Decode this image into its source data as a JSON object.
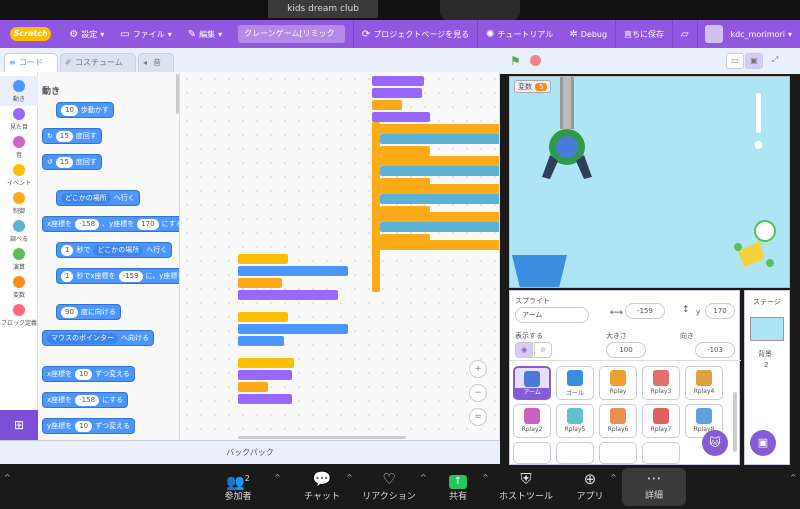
{
  "zoom": {
    "window_title": "kids dream club",
    "participants_count": "2",
    "toolbar": [
      {
        "label": "参加者",
        "icon": "participants-icon"
      },
      {
        "label": "チャット",
        "icon": "chat-icon"
      },
      {
        "label": "リアクション",
        "icon": "reaction-icon"
      },
      {
        "label": "共有",
        "icon": "share-icon"
      },
      {
        "label": "ホストツール",
        "icon": "host-tools-icon"
      },
      {
        "label": "アプリ",
        "icon": "apps-icon"
      },
      {
        "label": "詳細",
        "icon": "more-icon"
      }
    ]
  },
  "menubar": {
    "logo": "Scratch",
    "settings": "設定",
    "file": "ファイル",
    "edit": "編集",
    "project_title": "クレーンゲーム[リミックス...",
    "project_page": "プロジェクトページを見る",
    "tutorial": "チュートリアル",
    "debug": "Debug",
    "save_now": "直ちに保存",
    "username": "kdc_morimori"
  },
  "tabs": {
    "code": "コード",
    "costumes": "コスチューム",
    "sounds": "音"
  },
  "categories": [
    {
      "label": "動き",
      "color": "#4c97ff"
    },
    {
      "label": "見た目",
      "color": "#9966ff"
    },
    {
      "label": "音",
      "color": "#cf63cf"
    },
    {
      "label": "イベント",
      "color": "#ffbf00"
    },
    {
      "label": "制御",
      "color": "#ffab19"
    },
    {
      "label": "調べる",
      "color": "#5cb1d6"
    },
    {
      "label": "演算",
      "color": "#59c059"
    },
    {
      "label": "変数",
      "color": "#ff8c1a"
    },
    {
      "label": "ブロック定義",
      "color": "#ff6680"
    }
  ],
  "palette": {
    "title": "動き",
    "move": {
      "value": "10",
      "text": "歩動かす"
    },
    "turn_right": {
      "value": "15",
      "text": "度回す"
    },
    "turn_left": {
      "value": "15",
      "text": "度回す"
    },
    "goto": {
      "dropdown": "どこかの場所",
      "text": "へ行く"
    },
    "goto_xy": {
      "xlabel": "x座標を",
      "x": "-158",
      "ylabel": "、y座標を",
      "y": "170",
      "text": "にする"
    },
    "glide": {
      "value": "1",
      "text1": "秒で",
      "dropdown": "どこかの場所",
      "text2": "へ行く"
    },
    "glide_xy": {
      "value": "1",
      "text1": "秒でx座標を",
      "x": "-159",
      "text2": "に、y座標を"
    },
    "point_dir": {
      "value": "90",
      "text": "度に向ける"
    },
    "point_towards": {
      "dropdown": "マウスのポインター",
      "text": "へ向ける"
    },
    "change_x": {
      "text1": "x座標を",
      "value": "10",
      "text2": "ずつ変える"
    },
    "set_x": {
      "text1": "x座標を",
      "value": "-158",
      "text2": "にする"
    },
    "change_y": {
      "text1": "y座標を",
      "value": "10",
      "text2": "ずつ変える"
    }
  },
  "backpack": "バックパック",
  "stage": {
    "variable_label": "変数",
    "variable_value": "5"
  },
  "sprite": {
    "label": "スプライト",
    "name": "アーム",
    "x_value": "-159",
    "y_value": "170",
    "show_label": "表示する",
    "size_label": "大きさ",
    "size_value": "100",
    "direction_label": "向き",
    "direction_value": "-103",
    "y_axis": "y"
  },
  "sprites": [
    {
      "name": "アーム",
      "color": "#4b7bd8"
    },
    {
      "name": "ゴール",
      "color": "#3c8ee0"
    },
    {
      "name": "Rplay",
      "color": "#f0a030"
    },
    {
      "name": "Rplay3",
      "color": "#e07070"
    },
    {
      "name": "Rplay4",
      "color": "#e0a040"
    },
    {
      "name": "Rplay2",
      "color": "#d060c0"
    },
    {
      "name": "Rplay5",
      "color": "#60c0d0"
    },
    {
      "name": "Rplay6",
      "color": "#f09050"
    },
    {
      "name": "Rplay7",
      "color": "#e06060"
    },
    {
      "name": "Rplay8",
      "color": "#60a0e0"
    }
  ],
  "stage_pane": {
    "label": "ステージ",
    "backdrop_label": "背景",
    "backdrop_count": "2"
  }
}
